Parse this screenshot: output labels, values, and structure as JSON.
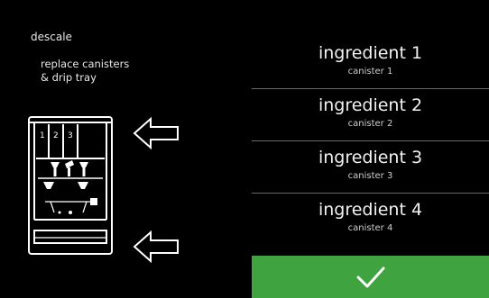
{
  "screen": {
    "title": "descale",
    "instructions": [
      "replace canisters",
      "& drip tray"
    ]
  },
  "machine_illustration": {
    "canister_labels": [
      "1",
      "2",
      "3"
    ]
  },
  "ingredients": [
    {
      "name": "ingredient 1",
      "canister": "canister 1"
    },
    {
      "name": "ingredient 2",
      "canister": "canister 2"
    },
    {
      "name": "ingredient 3",
      "canister": "canister 3"
    },
    {
      "name": "ingredient 4",
      "canister": "canister 4"
    }
  ],
  "confirm": {
    "icon": "checkmark-icon",
    "color": "#3fa33f"
  },
  "colors": {
    "background": "#000000",
    "text": "#ffffff",
    "divider": "#6a6a6a"
  }
}
